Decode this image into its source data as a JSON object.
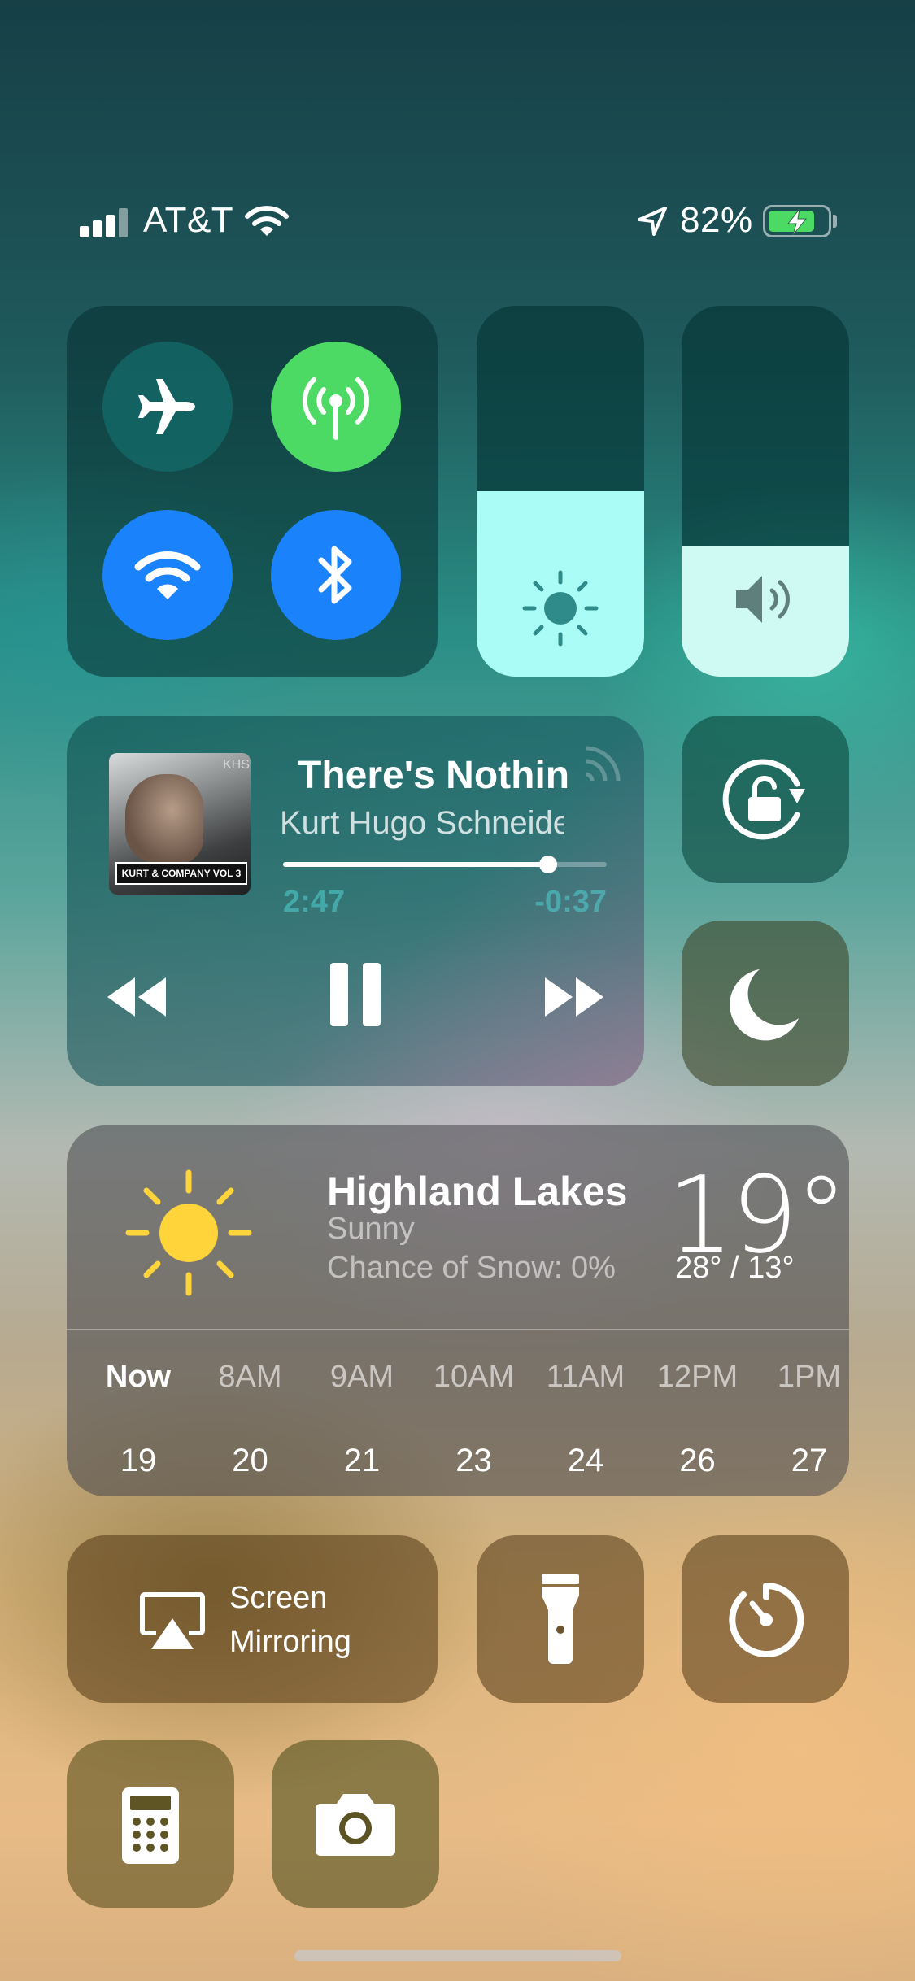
{
  "status_bar": {
    "carrier": "AT&T",
    "battery_percent": "82%",
    "battery_level": 0.82,
    "icons": [
      "cellular-signal-icon",
      "wifi-icon",
      "location-arrow-icon",
      "battery-charging-icon"
    ]
  },
  "connectivity": {
    "airplane": {
      "icon": "airplane-icon",
      "on": false
    },
    "cellular": {
      "icon": "cellular-antenna-icon",
      "on": true,
      "color": "#4cd964"
    },
    "wifi": {
      "icon": "wifi-icon",
      "on": true,
      "color": "#1a82fb"
    },
    "bluetooth": {
      "icon": "bluetooth-icon",
      "on": true,
      "color": "#1a82fb"
    }
  },
  "brightness": {
    "icon": "sun-icon",
    "level": 0.5
  },
  "volume": {
    "icon": "speaker-icon",
    "level": 0.35
  },
  "now_playing": {
    "album_text": "KURT & COMPANY VOL 3",
    "album_badge": "KHS",
    "title": "There's Nothin",
    "artist": "Kurt Hugo Schneide",
    "elapsed": "2:47",
    "remaining": "-0:37",
    "progress": 0.82,
    "icons": [
      "airplay-audio-icon",
      "rewind-icon",
      "pause-icon",
      "fast-forward-icon"
    ]
  },
  "orientation_lock": {
    "icon": "rotation-lock-icon"
  },
  "do_not_disturb": {
    "icon": "moon-icon"
  },
  "weather": {
    "city": "Highland Lakes",
    "condition": "Sunny",
    "chance": "Chance of Snow: 0%",
    "temp": "19°",
    "high_low": "28° / 13°",
    "icon": "sun-icon",
    "hours": [
      {
        "label": "Now",
        "value": "19"
      },
      {
        "label": "8AM",
        "value": "20"
      },
      {
        "label": "9AM",
        "value": "21"
      },
      {
        "label": "10AM",
        "value": "23"
      },
      {
        "label": "11AM",
        "value": "24"
      },
      {
        "label": "12PM",
        "value": "26"
      },
      {
        "label": "1PM",
        "value": "27"
      }
    ]
  },
  "screen_mirroring": {
    "line1": "Screen",
    "line2": "Mirroring",
    "icon": "screen-mirroring-icon"
  },
  "flashlight": {
    "icon": "flashlight-icon"
  },
  "timer": {
    "icon": "timer-icon"
  },
  "calculator": {
    "icon": "calculator-icon"
  },
  "camera": {
    "icon": "camera-icon"
  }
}
